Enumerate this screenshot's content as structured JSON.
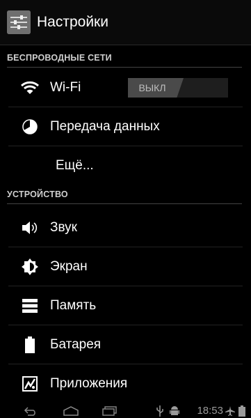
{
  "app": {
    "title": "Настройки",
    "icon": "settings-app-icon"
  },
  "sections": {
    "wireless": {
      "header": "БЕСПРОВОДНЫЕ СЕТИ"
    },
    "device": {
      "header": "УСТРОЙСТВО"
    }
  },
  "items": {
    "wifi": {
      "label": "Wi-Fi",
      "toggle": "ВЫКЛ",
      "icon": "wifi-icon"
    },
    "data": {
      "label": "Передача данных",
      "icon": "data-usage-icon"
    },
    "more": {
      "label": "Ещё..."
    },
    "sound": {
      "label": "Звук",
      "icon": "sound-icon"
    },
    "display": {
      "label": "Экран",
      "icon": "display-icon"
    },
    "storage": {
      "label": "Память",
      "icon": "storage-icon"
    },
    "battery": {
      "label": "Батарея",
      "icon": "battery-icon"
    },
    "apps": {
      "label": "Приложения",
      "icon": "apps-icon"
    }
  },
  "statusbar": {
    "time": "18:53"
  },
  "colors": {
    "background": "#000000",
    "text": "#ffffff",
    "secondary": "#9a9a9a",
    "toggle_off": "#4a4a4a"
  }
}
